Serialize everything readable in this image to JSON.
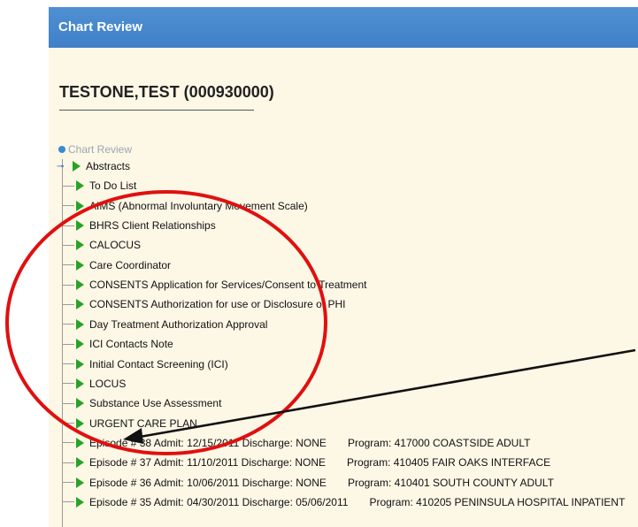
{
  "window": {
    "title": "Chart Review"
  },
  "patient": {
    "name": "TESTONE,TEST (000930000)"
  },
  "tree": {
    "root": "Chart Review",
    "items": [
      {
        "label": "Abstracts",
        "program": ""
      },
      {
        "label": "To Do List",
        "program": ""
      },
      {
        "label": "AIMS (Abnormal Involuntary Movement Scale)",
        "program": ""
      },
      {
        "label": "BHRS Client Relationships",
        "program": ""
      },
      {
        "label": "CALOCUS",
        "program": ""
      },
      {
        "label": "Care Coordinator",
        "program": ""
      },
      {
        "label": "CONSENTS Application for Services/Consent to Treatment",
        "program": ""
      },
      {
        "label": "CONSENTS Authorization for use or Disclosure of PHI",
        "program": ""
      },
      {
        "label": "Day Treatment Authorization Approval",
        "program": ""
      },
      {
        "label": "ICI Contacts Note",
        "program": ""
      },
      {
        "label": "Initial Contact Screening (ICI)",
        "program": ""
      },
      {
        "label": "LOCUS",
        "program": ""
      },
      {
        "label": "Substance Use Assessment",
        "program": ""
      },
      {
        "label": "URGENT CARE PLAN",
        "program": ""
      },
      {
        "label": "Episode # 38 Admit: 12/15/2011 Discharge: NONE",
        "program": "Program: 417000 COASTSIDE ADULT"
      },
      {
        "label": "Episode # 37 Admit: 11/10/2011 Discharge: NONE",
        "program": "Program: 410405 FAIR OAKS INTERFACE"
      },
      {
        "label": "Episode # 36 Admit: 10/06/2011 Discharge: NONE",
        "program": "Program: 410401 SOUTH COUNTY ADULT"
      },
      {
        "label": "Episode # 35 Admit: 04/30/2011 Discharge: 05/06/2011",
        "program": "Program: 410205 PENINSULA HOSPITAL INPATIENT"
      }
    ]
  },
  "colors": {
    "titlebar": "#4f90d3",
    "panel": "#fdf7e6",
    "tree_arrow": "#27a327",
    "annotation": "#e01010"
  }
}
